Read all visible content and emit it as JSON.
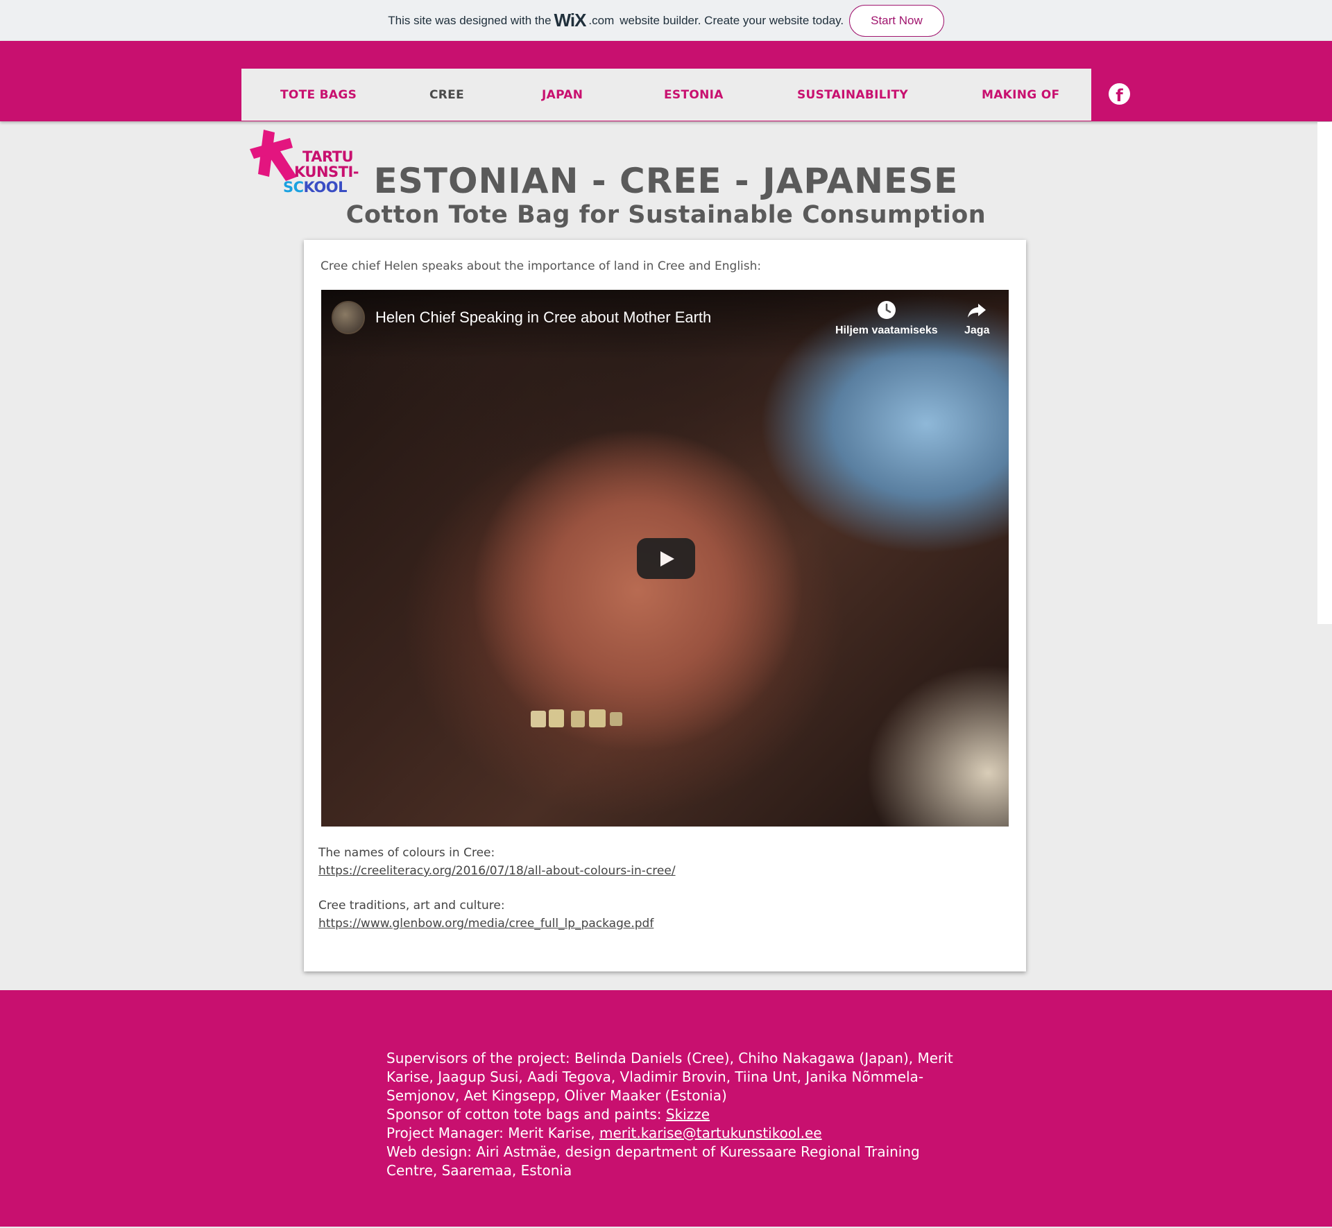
{
  "banner": {
    "text_before": "This site was designed with the",
    "wix_logo": "WiX",
    "wix_dotcom": ".com",
    "text_after": "website builder. Create your website today.",
    "start_label": "Start Now"
  },
  "nav": {
    "items": [
      {
        "label": "TOTE BAGS",
        "active": false
      },
      {
        "label": "CREE",
        "active": true
      },
      {
        "label": "JAPAN",
        "active": false
      },
      {
        "label": "ESTONIA",
        "active": false
      },
      {
        "label": "SUSTAINABILITY",
        "active": false
      },
      {
        "label": "MAKING OF",
        "active": false
      }
    ],
    "social_icon": "facebook-icon"
  },
  "logo": {
    "line1": "TARTU",
    "line2": "KUNSTI-",
    "line3a": "SC",
    "line3b": "KOOL"
  },
  "page": {
    "title": "ESTONIAN - CREE - JAPANESE",
    "subtitle": "Cotton Tote Bag for Sustainable Consumption"
  },
  "content": {
    "intro": "Cree chief Helen speaks about the importance of land in Cree and English:",
    "video": {
      "title": "Helen Chief Speaking in Cree about Mother Earth",
      "watch_later_label": "Hiljem vaatamiseks",
      "share_label": "Jaga"
    },
    "colours_label": "The names of colours in Cree:",
    "colours_link": "https://creeliteracy.org/2016/07/18/all-about-colours-in-cree/",
    "traditions_label": "Cree traditions, art and culture:",
    "traditions_link": "https://www.glenbow.org/media/cree_full_lp_package.pdf"
  },
  "footer": {
    "supervisors": "Supervisors of the project: Belinda Daniels (Cree), Chiho Nakagawa (Japan), Merit Karise, Jaagup Susi, Aadi Tegova, Vladimir Brovin, Tiina Unt, Janika Nõmmela-Semjonov, Aet Kingsepp, Oliver Maaker (Estonia)",
    "sponsor_label": "Sponsor of cotton tote bags and paints:",
    "sponsor_link": "Skizze",
    "manager_label": "Project Manager: Merit Karise,",
    "manager_email": "merit.karise@tartukunstikool.ee",
    "web_design": "Web design: Airi Astmäe, design department of Kuressaare Regional Training Centre, Saaremaa, Estonia"
  },
  "colors": {
    "brand_magenta": "#c8106f",
    "logo_blue": "#1aa1e0"
  }
}
